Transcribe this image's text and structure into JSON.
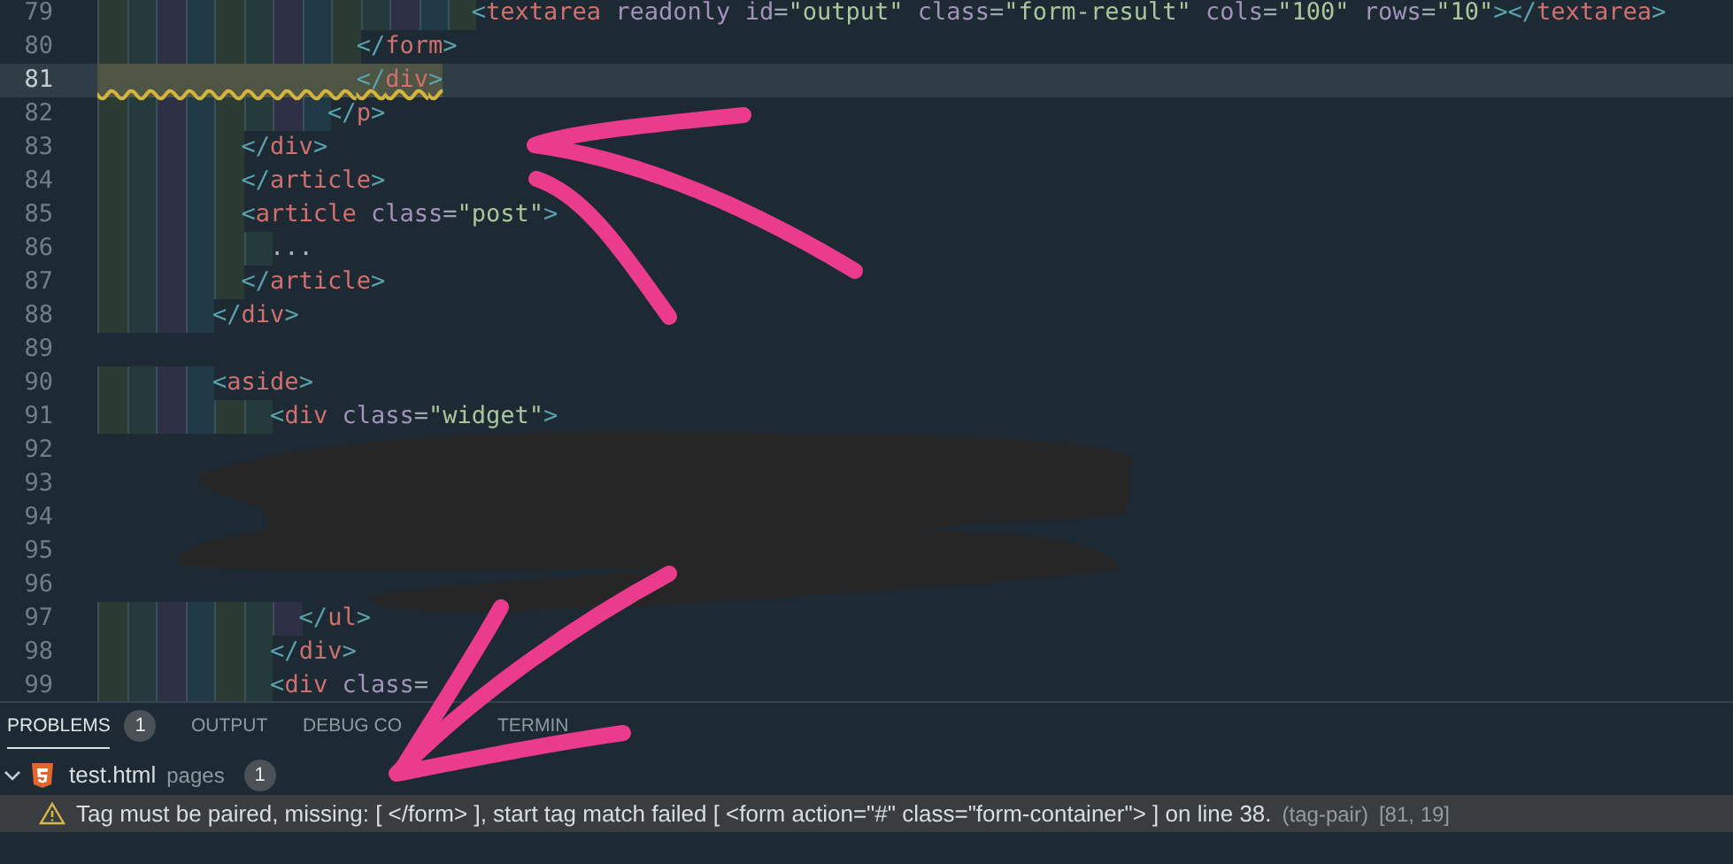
{
  "editor": {
    "lines": [
      {
        "number": "79",
        "code": "                          <textarea readonly id=\"output\" class=\"form-result\" cols=\"100\" rows=\"10\"></textarea>",
        "current": false,
        "warning": false
      },
      {
        "number": "80",
        "code": "                  </form>",
        "current": false,
        "warning": false
      },
      {
        "number": "81",
        "code": "                  </div>",
        "current": true,
        "warning": true
      },
      {
        "number": "82",
        "code": "                </p>",
        "current": false,
        "warning": false
      },
      {
        "number": "83",
        "code": "          </div>",
        "current": false,
        "warning": false
      },
      {
        "number": "84",
        "code": "          </article>",
        "current": false,
        "warning": false
      },
      {
        "number": "85",
        "code": "          <article class=\"post\">",
        "current": false,
        "warning": false
      },
      {
        "number": "86",
        "code": "            ...",
        "current": false,
        "warning": false
      },
      {
        "number": "87",
        "code": "          </article>",
        "current": false,
        "warning": false
      },
      {
        "number": "88",
        "code": "        </div>",
        "current": false,
        "warning": false
      },
      {
        "number": "89",
        "current": false
      },
      {
        "number": "90",
        "code": "        <aside>",
        "current": false,
        "warning": false
      },
      {
        "number": "91",
        "code": "            <div class=\"widget\">",
        "current": false,
        "warning": false
      },
      {
        "number": "92",
        "current": false
      },
      {
        "number": "93",
        "current": false
      },
      {
        "number": "94",
        "current": false
      },
      {
        "number": "95",
        "current": false
      },
      {
        "number": "96",
        "current": false
      },
      {
        "number": "97",
        "code": "              </ul>",
        "current": false,
        "warning": false
      },
      {
        "number": "98",
        "code": "            </div>",
        "current": false,
        "warning": false
      },
      {
        "number": "99",
        "code": "            <div class=",
        "current": false,
        "warning": false
      }
    ]
  },
  "panel": {
    "tabs": [
      {
        "label": "PROBLEMS",
        "badge": "1",
        "selected": true
      },
      {
        "label": "OUTPUT",
        "selected": false
      },
      {
        "label": "DEBUG CO",
        "selected": false
      },
      {
        "label": "TERMIN",
        "selected": false
      }
    ],
    "files": [
      {
        "name": "test.html",
        "folder": "pages",
        "count": "1",
        "expanded": true,
        "problems": [
          {
            "kind": "warning",
            "message": "Tag must be paired, missing: [ </form> ], start tag match failed [ <form action=\"#\" class=\"form-container\"> ] on line 38.",
            "source": "(tag-pair)",
            "position": "[81, 19]",
            "selected": true
          }
        ]
      }
    ]
  }
}
